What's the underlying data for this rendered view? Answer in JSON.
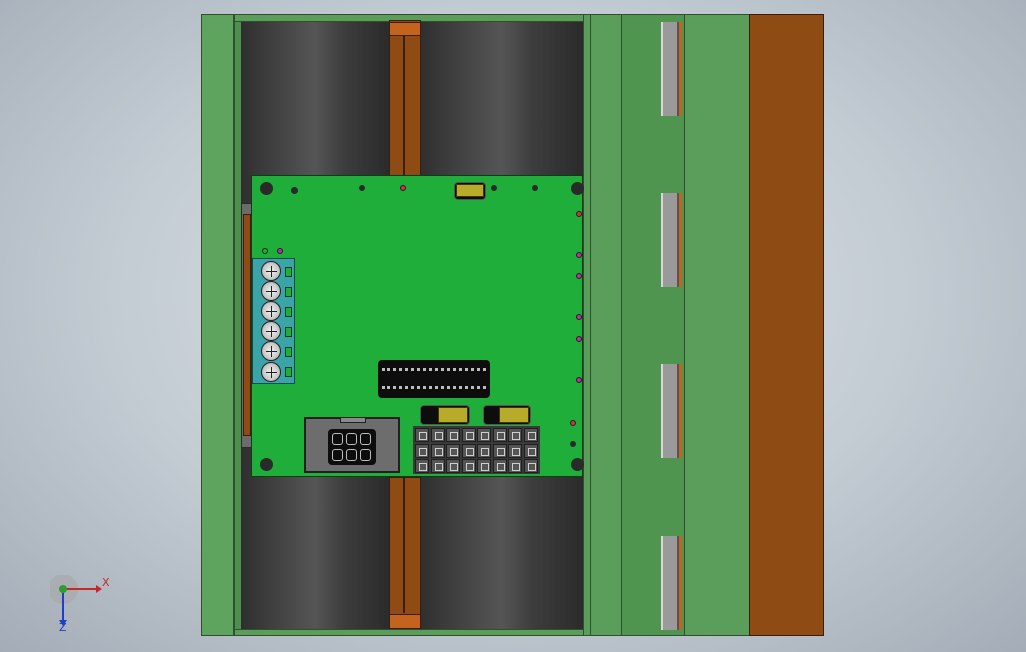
{
  "triad": {
    "x_label": "X",
    "z_label": "Z",
    "colors": {
      "x": "#c62828",
      "y": "#2e9e2e",
      "z": "#1e40c8"
    }
  },
  "colors": {
    "frame": "#5b9e5b",
    "pcb": "#1fae3a",
    "copper": "#8e4c14",
    "terminal": "#3aa4a8",
    "capacitor": "#b8ab29"
  }
}
